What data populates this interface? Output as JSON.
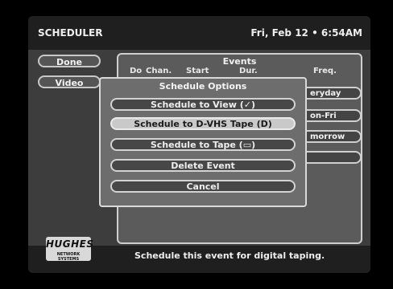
{
  "header": {
    "title": "SCHEDULER",
    "datetime": "Fri, Feb 12 • 6:54AM"
  },
  "sidebar": {
    "buttons": [
      {
        "label": "Done"
      },
      {
        "label": "Video"
      }
    ]
  },
  "events": {
    "title": "Events",
    "columns": [
      "Do",
      "Chan.",
      "Start",
      "Dur.",
      "Freq."
    ],
    "freq_values": [
      "eryday",
      "on-Fri",
      "morrow",
      ""
    ]
  },
  "popup": {
    "title": "Schedule Options",
    "options": [
      "Schedule to View (✓)",
      "Schedule to D-VHS Tape (D)",
      "Schedule to Tape (▭)",
      "Delete Event",
      "Cancel"
    ],
    "selected_index": 1
  },
  "footer": {
    "logo": "HUGHES",
    "logo_sub": "NETWORK SYSTEMS",
    "status": "Schedule this event for digital taping."
  }
}
